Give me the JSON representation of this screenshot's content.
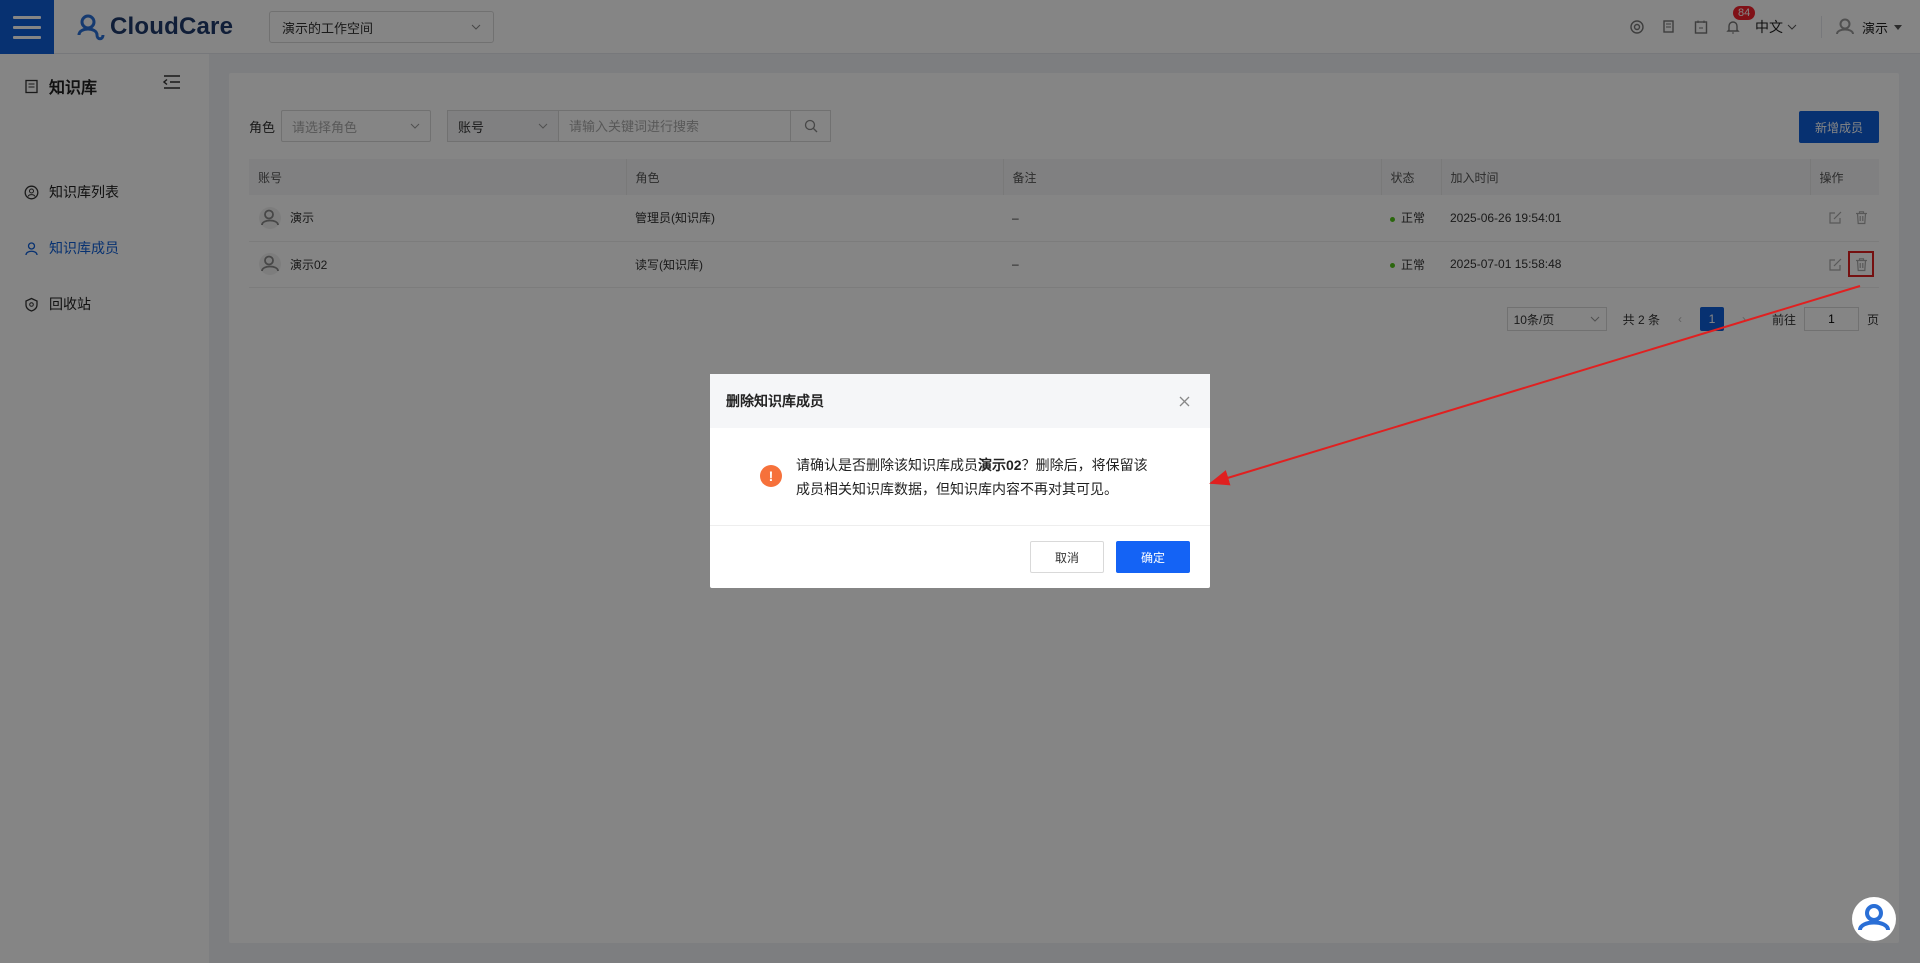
{
  "header": {
    "logo_text": "CloudCare",
    "workspace": "演示的工作空间",
    "notification_count": "84",
    "language": "中文",
    "user_name": "演示"
  },
  "sidebar": {
    "title": "知识库",
    "items": [
      {
        "label": "知识库列表",
        "icon": "user-circle-icon",
        "active": false
      },
      {
        "label": "知识库成员",
        "icon": "users-icon",
        "active": true
      },
      {
        "label": "回收站",
        "icon": "recycle-icon",
        "active": false
      }
    ]
  },
  "filter": {
    "role_label": "角色",
    "role_placeholder": "请选择角色",
    "field_select": "账号",
    "keyword_placeholder": "请输入关键词进行搜索",
    "add_button": "新增成员"
  },
  "table": {
    "headers": [
      "账号",
      "角色",
      "备注",
      "状态",
      "加入时间",
      "操作"
    ],
    "rows": [
      {
        "account": "演示",
        "role": "管理员(知识库)",
        "note": "–",
        "status": "正常",
        "joined": "2025-06-26 19:54:01"
      },
      {
        "account": "演示02",
        "role": "读写(知识库)",
        "note": "–",
        "status": "正常",
        "joined": "2025-07-01 15:58:48"
      }
    ]
  },
  "pagination": {
    "page_size": "10条/页",
    "total": "共 2 条",
    "current": "1",
    "goto_label": "前往",
    "goto_value": "1",
    "page_suffix": "页"
  },
  "modal": {
    "title": "删除知识库成员",
    "message_before": "请确认是否删除该知识库成员",
    "member_name": "演示02",
    "message_after": "？删除后，将保留该成员相关知识库数据，但知识库内容不再对其可见。",
    "cancel": "取消",
    "confirm": "确定"
  },
  "colors": {
    "brand": "#0e5fd8",
    "primary_button": "#1463f5",
    "warning": "#f6713b",
    "status_ok": "#52c41a",
    "annotation": "#e02020"
  }
}
